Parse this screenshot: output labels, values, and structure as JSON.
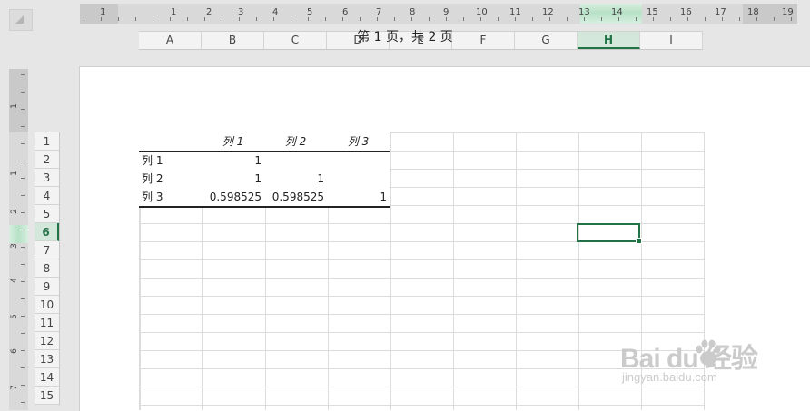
{
  "ruler": {
    "numbers": [
      "1",
      "1",
      "2",
      "3",
      "4",
      "5",
      "6",
      "7",
      "8",
      "9",
      "10",
      "11",
      "12",
      "13",
      "14",
      "15",
      "16",
      "17",
      "18",
      "19"
    ],
    "vertical_numbers": [
      "1",
      "1",
      "2",
      "3",
      "4",
      "5",
      "6",
      "7"
    ]
  },
  "columns": [
    "A",
    "B",
    "C",
    "D",
    "E",
    "F",
    "G",
    "H",
    "I"
  ],
  "selected_column": "H",
  "rows": [
    "1",
    "2",
    "3",
    "4",
    "5",
    "6",
    "7",
    "8",
    "9",
    "10",
    "11",
    "12",
    "13",
    "14",
    "15"
  ],
  "selected_row": "6",
  "page_header": "第 1 页，共 2 页",
  "table": {
    "headers": [
      "",
      "列 1",
      "列 2",
      "列 3"
    ],
    "rows": [
      [
        "列 1",
        "1",
        "",
        ""
      ],
      [
        "列 2",
        "1",
        "1",
        ""
      ],
      [
        "列 3",
        "0.598525",
        "0.598525",
        "1"
      ]
    ]
  },
  "watermark": {
    "brand": "Bai  du 经验",
    "url": "jingyan.baidu.com"
  },
  "colors": {
    "accent": "#217346",
    "grid": "#dcdcdc",
    "header_bg": "#f3f3f3"
  }
}
